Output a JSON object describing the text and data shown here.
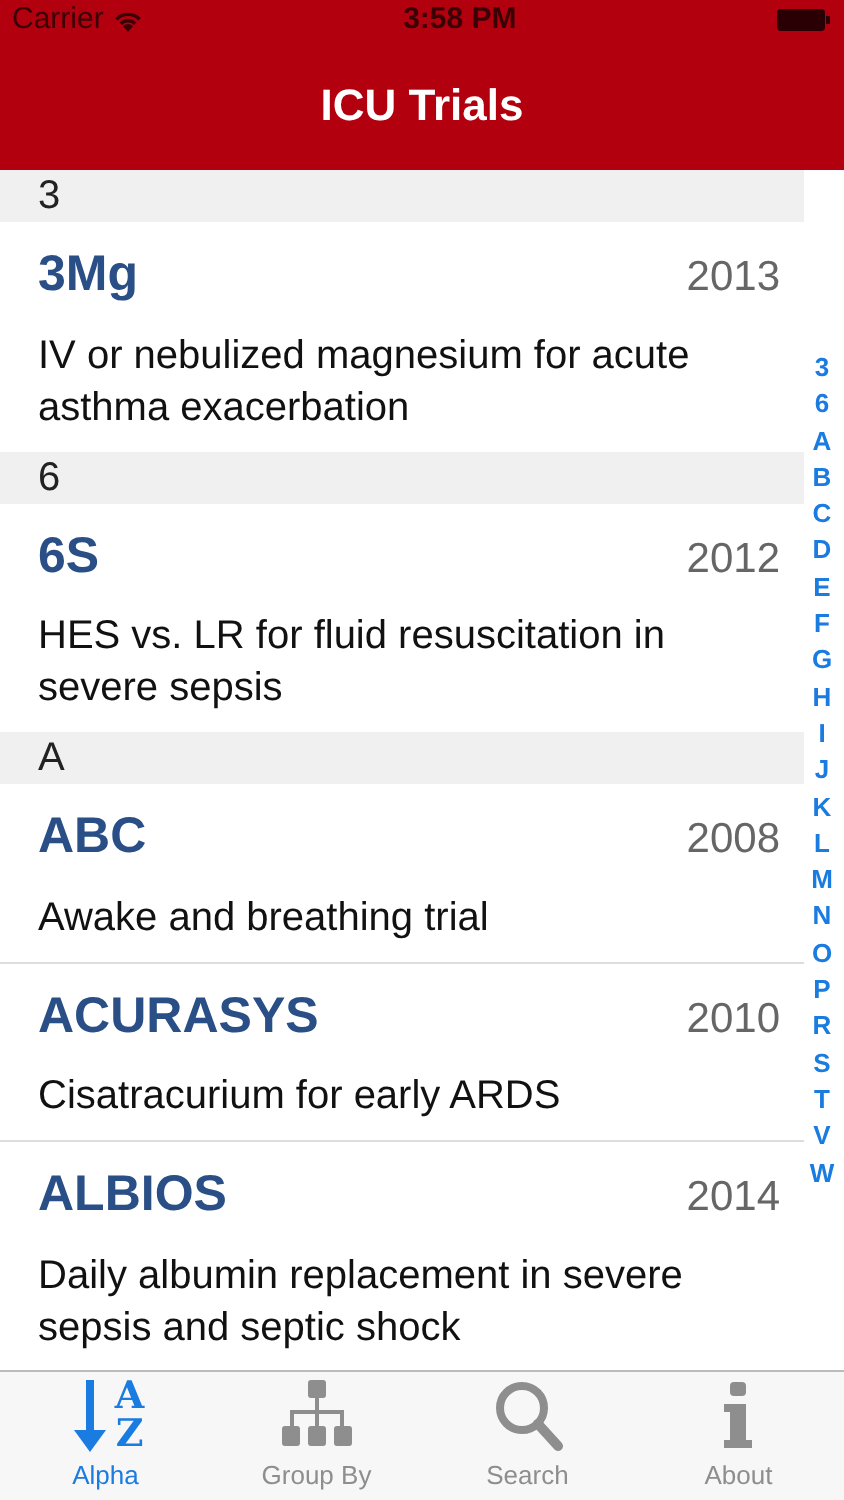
{
  "status_bar": {
    "carrier": "Carrier",
    "time": "3:58 PM"
  },
  "nav": {
    "title": "ICU Trials"
  },
  "sections": [
    {
      "header": "3",
      "trials": [
        {
          "name": "3Mg",
          "year": "2013",
          "description": "IV or nebulized magnesium for acute asthma exacerbation"
        }
      ]
    },
    {
      "header": "6",
      "trials": [
        {
          "name": "6S",
          "year": "2012",
          "description": "HES vs. LR for fluid resuscitation in severe sepsis"
        }
      ]
    },
    {
      "header": "A",
      "trials": [
        {
          "name": "ABC",
          "year": "2008",
          "description": "Awake and breathing trial"
        },
        {
          "name": "ACURASYS",
          "year": "2010",
          "description": "Cisatracurium for early ARDS"
        },
        {
          "name": "ALBIOS",
          "year": "2014",
          "description": "Daily albumin replacement in severe sepsis and septic shock"
        }
      ]
    }
  ],
  "index": [
    "3",
    "6",
    "A",
    "B",
    "C",
    "D",
    "E",
    "F",
    "G",
    "H",
    "I",
    "J",
    "K",
    "L",
    "M",
    "N",
    "O",
    "P",
    "R",
    "S",
    "T",
    "V",
    "W"
  ],
  "tabs": [
    {
      "kind": "alpha",
      "label": "Alpha",
      "selected": true,
      "icon_text": [
        "A",
        "Z"
      ]
    },
    {
      "kind": "group",
      "label": "Group By",
      "selected": false
    },
    {
      "kind": "search",
      "label": "Search",
      "selected": false
    },
    {
      "kind": "about",
      "label": "About",
      "selected": false
    }
  ]
}
